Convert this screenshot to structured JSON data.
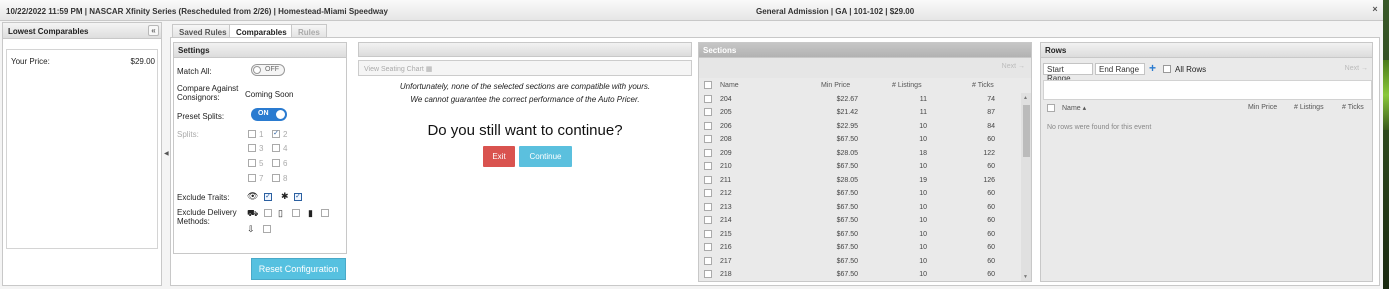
{
  "topbar": {
    "event": "10/22/2022   11:59 PM   |   NASCAR Xfinity Series (Rescheduled from 2/26)   |   Homestead-Miami Speedway",
    "ticket": "General Admission   |   GA   |   101-102   |   $29.00",
    "close_icon": "×"
  },
  "left_panel": {
    "title": "Lowest Comparables",
    "collapse_icon": "«",
    "your_price_label": "Your Price:",
    "your_price_value": "$29.00"
  },
  "tabs": [
    "Saved Rules",
    "Comparables",
    "Rules"
  ],
  "settings": {
    "title": "Settings",
    "match_all_label": "Match All:",
    "match_all_toggle": "OFF",
    "compare_label": "Compare Against Consignors:",
    "compare_value": "Coming Soon",
    "preset_splits_label": "Preset Splits:",
    "preset_splits_toggle": "ON",
    "splits_label": "Splits:",
    "splits": [
      "1",
      "2",
      "3",
      "4",
      "5",
      "6",
      "7",
      "8"
    ],
    "exclude_traits_label": "Exclude Traits:",
    "exclude_delivery_label": "Exclude Delivery Methods:",
    "reset_button": "Reset Configuration"
  },
  "chart": {
    "view_seating_chart": "View Seating Chart",
    "warning_line1": "Unfortunately, none of the selected sections are compatible with yours.",
    "warning_line2": "We cannot guarantee the correct performance of the Auto Pricer.",
    "question": "Do you still want to continue?",
    "exit_button": "Exit",
    "continue_button": "Continue"
  },
  "sections": {
    "title": "Sections",
    "next_link": "Next →",
    "columns": [
      "Name",
      "Min Price",
      "# Listings",
      "# Ticks"
    ],
    "rows": [
      {
        "name": "204",
        "min_price": "$22.67",
        "listings": "11",
        "ticks": "74"
      },
      {
        "name": "205",
        "min_price": "$21.42",
        "listings": "11",
        "ticks": "87"
      },
      {
        "name": "206",
        "min_price": "$22.95",
        "listings": "10",
        "ticks": "84"
      },
      {
        "name": "208",
        "min_price": "$67.50",
        "listings": "10",
        "ticks": "60"
      },
      {
        "name": "209",
        "min_price": "$28.05",
        "listings": "18",
        "ticks": "122"
      },
      {
        "name": "210",
        "min_price": "$67.50",
        "listings": "10",
        "ticks": "60"
      },
      {
        "name": "211",
        "min_price": "$28.05",
        "listings": "19",
        "ticks": "126"
      },
      {
        "name": "212",
        "min_price": "$67.50",
        "listings": "10",
        "ticks": "60"
      },
      {
        "name": "213",
        "min_price": "$67.50",
        "listings": "10",
        "ticks": "60"
      },
      {
        "name": "214",
        "min_price": "$67.50",
        "listings": "10",
        "ticks": "60"
      },
      {
        "name": "215",
        "min_price": "$67.50",
        "listings": "10",
        "ticks": "60"
      },
      {
        "name": "216",
        "min_price": "$67.50",
        "listings": "10",
        "ticks": "60"
      },
      {
        "name": "217",
        "min_price": "$67.50",
        "listings": "10",
        "ticks": "60"
      },
      {
        "name": "218",
        "min_price": "$67.50",
        "listings": "10",
        "ticks": "60"
      }
    ]
  },
  "rows_panel": {
    "title": "Rows",
    "start_range_placeholder": "Start Range",
    "end_range_placeholder": "End Range",
    "plus_icon": "+",
    "all_rows_label": "All Rows",
    "next_link": "Next →",
    "columns": [
      "Name ▴",
      "Min Price",
      "# Listings",
      "# Ticks"
    ],
    "empty_message": "No rows were found for this event"
  }
}
